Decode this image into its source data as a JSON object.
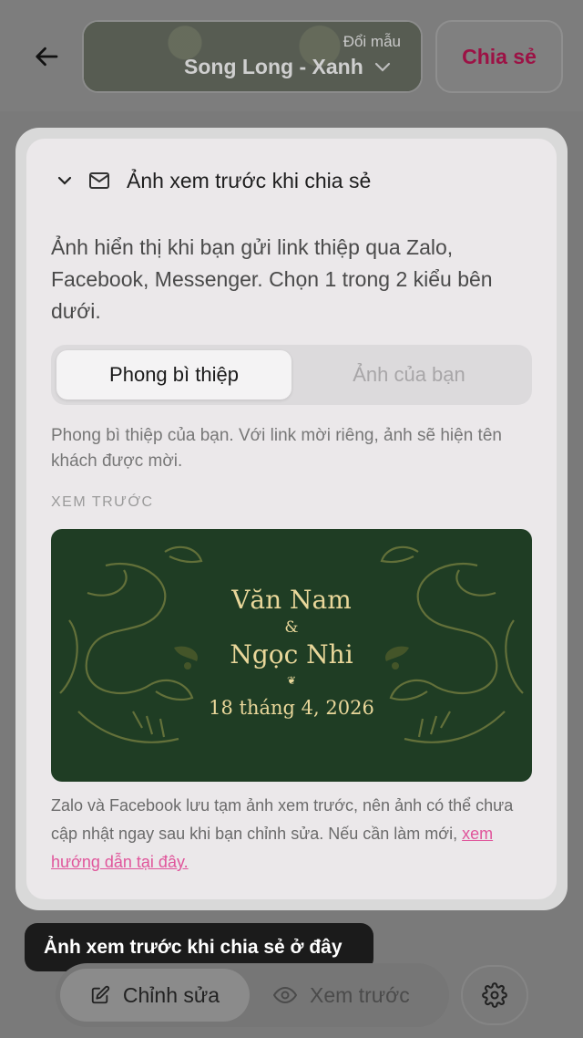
{
  "header": {
    "back_icon": "arrow-left-icon",
    "picker_caption": "Đổi mẫu",
    "picker_value": "Song Long - Xanh",
    "share_label": "Chia sẻ"
  },
  "panel": {
    "title": "Ảnh xem trước khi chia sẻ",
    "description": "Ảnh hiển thị khi bạn gửi link thiệp qua Zalo, Facebook, Messenger. Chọn 1 trong 2 kiểu bên dưới.",
    "tabs": [
      {
        "label": "Phong bì thiệp",
        "selected": true
      },
      {
        "label": "Ảnh của bạn",
        "selected": false
      }
    ],
    "hint": "Phong bì thiệp của bạn. Với link mời riêng, ảnh sẽ hiện tên khách được mời.",
    "preview_label": "XEM TRƯỚC",
    "card": {
      "name1": "Văn Nam",
      "ampersand": "&",
      "name2": "Ngọc Nhi",
      "flourish": "❦",
      "date": "18 tháng 4, 2026",
      "background_color": "#1f3d24",
      "text_color": "#e9d79a"
    },
    "footnote": "Zalo và Facebook lưu tạm ảnh xem trước, nên ảnh có thể chưa cập nhật ngay sau khi bạn chỉnh sửa. Nếu cần làm mới,",
    "footnote_link": "xem hướng dẫn tại đây."
  },
  "tooltip": "Ảnh xem trước khi chia sẻ ở đây",
  "bottom": {
    "edit_label": "Chỉnh sửa",
    "preview_label": "Xem trước"
  },
  "colors": {
    "accent": "#9c1245",
    "link": "#e0559b"
  }
}
